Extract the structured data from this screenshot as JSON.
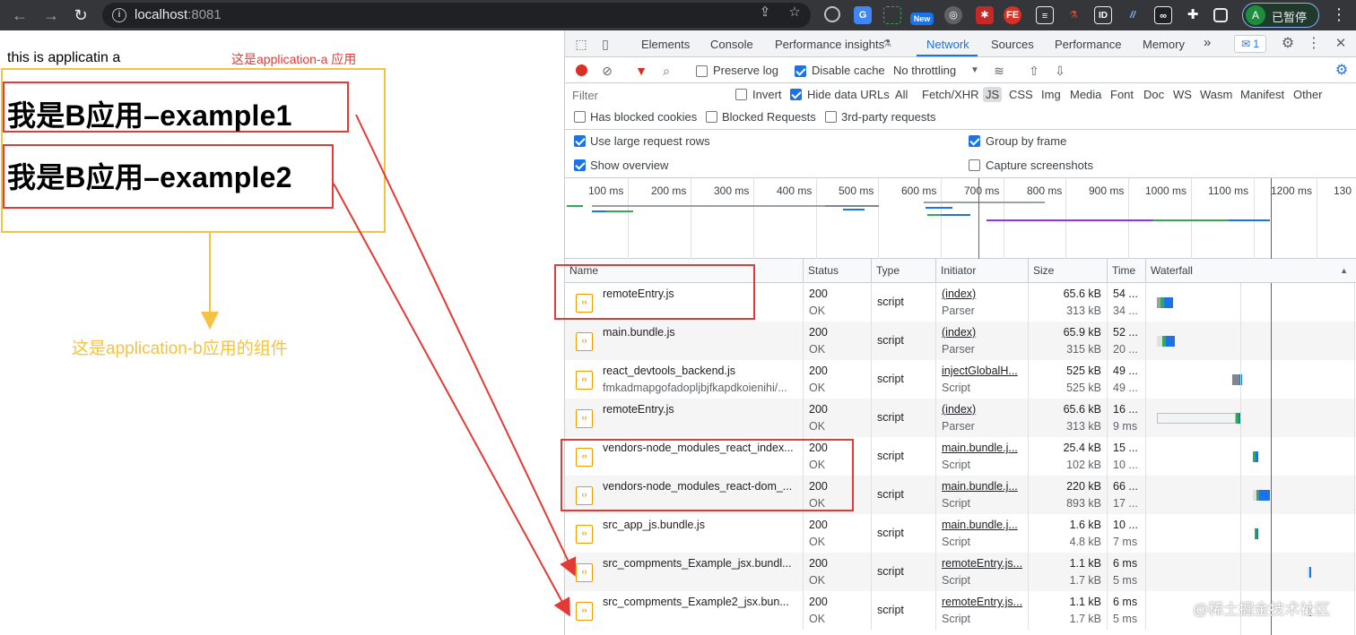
{
  "browser": {
    "url_host": "localhost",
    "url_port": ":8081",
    "profile_initial": "A",
    "profile_label": "已暂停",
    "ext_new": "New",
    "ext_fe": "FE",
    "ext_id": "ID"
  },
  "page": {
    "app_a_title": "this is applicatin a",
    "anno_app_a": "这是application-a 应用",
    "example1": "我是B应用–example1",
    "example2": "我是B应用–example2",
    "anno_app_b": "这是application-b应用的组件",
    "colors": {
      "annotation_red": "#e53935",
      "annotation_yellow": "#f5c242"
    }
  },
  "devtools": {
    "tabs": [
      "Elements",
      "Console",
      "Performance insights",
      "Network",
      "Sources",
      "Performance",
      "Memory"
    ],
    "active_tab": "Network",
    "more_tabs": "»",
    "issues_count": "1",
    "toolbar": {
      "preserve_log": "Preserve log",
      "disable_cache": "Disable cache",
      "throttling": "No throttling"
    },
    "filter": {
      "placeholder": "Filter",
      "invert": "Invert",
      "hide_data_urls": "Hide data URLs",
      "types": [
        "All",
        "Fetch/XHR",
        "JS",
        "CSS",
        "Img",
        "Media",
        "Font",
        "Doc",
        "WS",
        "Wasm",
        "Manifest",
        "Other"
      ],
      "active_type": "JS",
      "has_blocked_cookies": "Has blocked cookies",
      "blocked_requests": "Blocked Requests",
      "third_party": "3rd-party requests"
    },
    "settings": {
      "large_rows": "Use large request rows",
      "group_by_frame": "Group by frame",
      "show_overview": "Show overview",
      "capture_screenshots": "Capture screenshots"
    },
    "overview_ticks": [
      "100 ms",
      "200 ms",
      "300 ms",
      "400 ms",
      "500 ms",
      "600 ms",
      "700 ms",
      "800 ms",
      "900 ms",
      "1000 ms",
      "1100 ms",
      "1200 ms",
      "130"
    ],
    "columns": [
      "Name",
      "Status",
      "Type",
      "Initiator",
      "Size",
      "Time",
      "Waterfall"
    ],
    "rows": [
      {
        "name": "remoteEntry.js",
        "sub": "",
        "status": "200",
        "status_text": "OK",
        "type": "script",
        "initiator": "(index)",
        "initiator_sub": "Parser",
        "size": "65.6 kB",
        "size_sub": "313 kB",
        "time": "54 ...",
        "time_sub": "34 ..."
      },
      {
        "name": "main.bundle.js",
        "sub": "",
        "status": "200",
        "status_text": "OK",
        "type": "script",
        "initiator": "(index)",
        "initiator_sub": "Parser",
        "size": "65.9 kB",
        "size_sub": "315 kB",
        "time": "52 ...",
        "time_sub": "20 ..."
      },
      {
        "name": "react_devtools_backend.js",
        "sub": "fmkadmapgofadopljbjfkapdkoienihi/...",
        "status": "200",
        "status_text": "OK",
        "type": "script",
        "initiator": "injectGlobalH...",
        "initiator_sub": "Script",
        "size": "525 kB",
        "size_sub": "525 kB",
        "time": "49 ...",
        "time_sub": "49 ..."
      },
      {
        "name": "remoteEntry.js",
        "sub": "",
        "status": "200",
        "status_text": "OK",
        "type": "script",
        "initiator": "(index)",
        "initiator_sub": "Parser",
        "size": "65.6 kB",
        "size_sub": "313 kB",
        "time": "16 ...",
        "time_sub": "9 ms"
      },
      {
        "name": "vendors-node_modules_react_index...",
        "sub": "",
        "status": "200",
        "status_text": "OK",
        "type": "script",
        "initiator": "main.bundle.j...",
        "initiator_sub": "Script",
        "size": "25.4 kB",
        "size_sub": "102 kB",
        "time": "15 ...",
        "time_sub": "10 ..."
      },
      {
        "name": "vendors-node_modules_react-dom_...",
        "sub": "",
        "status": "200",
        "status_text": "OK",
        "type": "script",
        "initiator": "main.bundle.j...",
        "initiator_sub": "Script",
        "size": "220 kB",
        "size_sub": "893 kB",
        "time": "66 ...",
        "time_sub": "17 ..."
      },
      {
        "name": "src_app_js.bundle.js",
        "sub": "",
        "status": "200",
        "status_text": "OK",
        "type": "script",
        "initiator": "main.bundle.j...",
        "initiator_sub": "Script",
        "size": "1.6 kB",
        "size_sub": "4.8 kB",
        "time": "10 ...",
        "time_sub": "7 ms"
      },
      {
        "name": "src_compments_Example_jsx.bundl...",
        "sub": "",
        "status": "200",
        "status_text": "OK",
        "type": "script",
        "initiator": "remoteEntry.js...",
        "initiator_sub": "Script",
        "size": "1.1 kB",
        "size_sub": "1.7 kB",
        "time": "6 ms",
        "time_sub": "5 ms"
      },
      {
        "name": "src_compments_Example2_jsx.bun...",
        "sub": "",
        "status": "200",
        "status_text": "OK",
        "type": "script",
        "initiator": "remoteEntry.js...",
        "initiator_sub": "Script",
        "size": "1.1 kB",
        "size_sub": "1.7 kB",
        "time": "6 ms",
        "time_sub": "5 ms"
      }
    ]
  },
  "watermark": "@稀土掘金技术社区"
}
